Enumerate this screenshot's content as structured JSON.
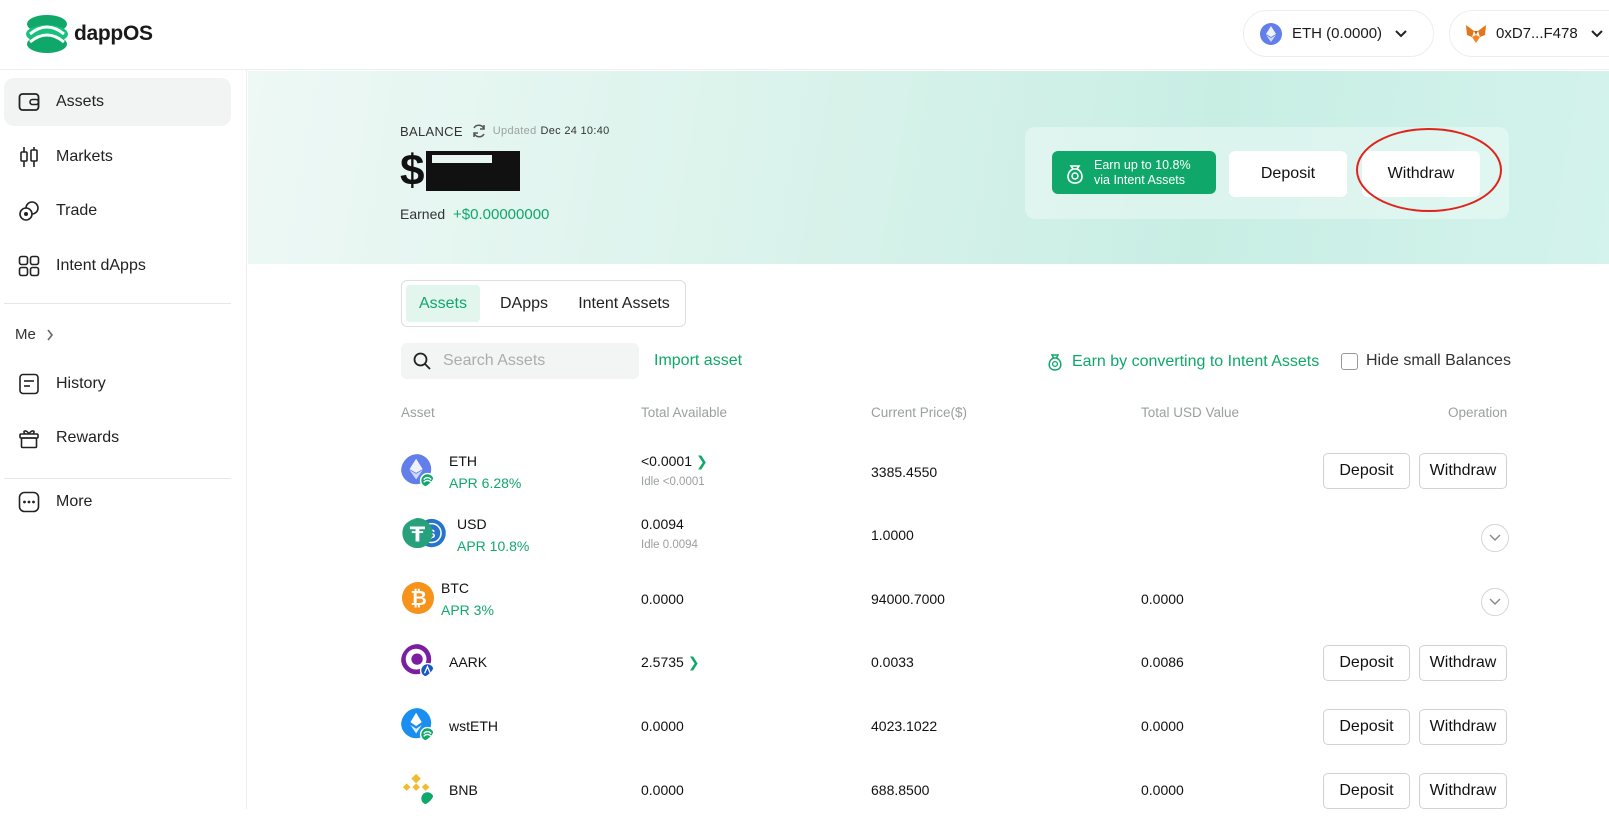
{
  "header": {
    "logo_text": "dappOS",
    "chain": "ETH (0.0000)",
    "wallet": "0xD7...F478"
  },
  "sidebar": {
    "items": [
      {
        "label": "Assets",
        "icon": "wallet-icon"
      },
      {
        "label": "Markets",
        "icon": "candlestick-icon"
      },
      {
        "label": "Trade",
        "icon": "swap-icon"
      },
      {
        "label": "Intent dApps",
        "icon": "grid-icon"
      }
    ],
    "me_label": "Me",
    "items2": [
      {
        "label": "History",
        "icon": "document-icon"
      },
      {
        "label": "Rewards",
        "icon": "gift-icon"
      }
    ],
    "more_label": "More"
  },
  "balance": {
    "label": "BALANCE",
    "updated_label": "Updated",
    "updated_time": "Dec 24 10:40",
    "currency_symbol": "$",
    "earned_label": "Earned",
    "earned_value": "+$0.00000000"
  },
  "hero_actions": {
    "earn_line1": "Earn up to 10.8%",
    "earn_line2": "via Intent Assets",
    "deposit": "Deposit",
    "withdraw": "Withdraw"
  },
  "tabs": [
    "Assets",
    "DApps",
    "Intent Assets"
  ],
  "toolbar": {
    "search_placeholder": "Search Assets",
    "import_label": "Import asset",
    "earn_convert_label": "Earn by converting to Intent Assets",
    "hide_small_label": "Hide small Balances"
  },
  "table": {
    "headers": [
      "Asset",
      "Total Available",
      "Current Price($)",
      "Total USD Value",
      "Operation"
    ],
    "deposit_label": "Deposit",
    "withdraw_label": "Withdraw",
    "rows": [
      {
        "symbol": "ETH",
        "apr": "APR 6.28%",
        "available": "<0.0001",
        "idle": "Idle <0.0001",
        "price": "3385.4550",
        "usd": "",
        "ops": "buttons"
      },
      {
        "symbol": "USD",
        "apr": "APR 10.8%",
        "available": "0.0094",
        "idle": "Idle 0.0094",
        "price": "1.0000",
        "usd": "",
        "ops": "expand"
      },
      {
        "symbol": "BTC",
        "apr": "APR 3%",
        "available": "0.0000",
        "idle": "",
        "price": "94000.7000",
        "usd": "0.0000",
        "ops": "expand"
      },
      {
        "symbol": "AARK",
        "apr": "",
        "available": "2.5735",
        "idle": "",
        "price": "0.0033",
        "usd": "0.0086",
        "ops": "buttons"
      },
      {
        "symbol": "wstETH",
        "apr": "",
        "available": "0.0000",
        "idle": "",
        "price": "4023.1022",
        "usd": "0.0000",
        "ops": "buttons"
      },
      {
        "symbol": "BNB",
        "apr": "",
        "available": "0.0000",
        "idle": "",
        "price": "688.8500",
        "usd": "0.0000",
        "ops": "buttons"
      }
    ]
  },
  "colors": {
    "accent": "#0fa86a",
    "annotation": "#e0241d"
  }
}
